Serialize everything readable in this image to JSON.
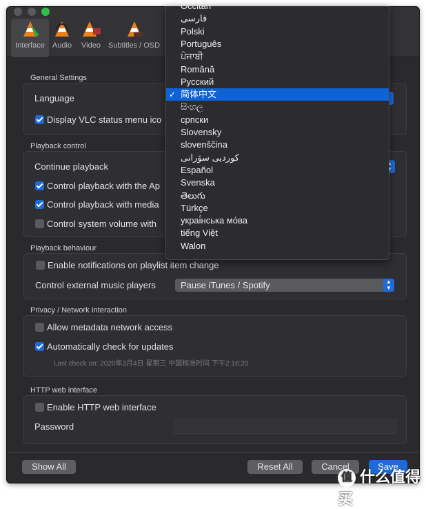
{
  "toolbar": {
    "tabs": [
      {
        "label": "Interface",
        "icon": "vlc-cone-interface-icon",
        "selected": true
      },
      {
        "label": "Audio",
        "icon": "vlc-cone-headphones-icon"
      },
      {
        "label": "Video",
        "icon": "vlc-cone-film-icon"
      },
      {
        "label": "Subtitles / OSD",
        "icon": "vlc-cone-subtitles-icon"
      }
    ]
  },
  "general": {
    "title": "General Settings",
    "language_label": "Language",
    "display_status_icon": {
      "label": "Display VLC status menu ico",
      "checked": true
    }
  },
  "playback_control": {
    "title": "Playback control",
    "continue_label": "Continue playback",
    "apple_remote": {
      "label": "Control playback with the Ap",
      "checked": true
    },
    "media_keys": {
      "label": "Control playback with media",
      "checked": true
    },
    "system_volume": {
      "label": "Control system volume with",
      "checked": false
    }
  },
  "playback_behaviour": {
    "title": "Playback behaviour",
    "notifications": {
      "label": "Enable notifications on playlist item change",
      "checked": false
    },
    "external_label": "Control external music players",
    "external_value": "Pause iTunes / Spotify"
  },
  "privacy": {
    "title": "Privacy / Network Interaction",
    "metadata": {
      "label": "Allow metadata network access",
      "checked": false
    },
    "updates": {
      "label": "Automatically check for updates",
      "checked": true
    },
    "last_check": "Last check on: 2020年3月4日 星期三 中国标准时间 下午2:16:20"
  },
  "http": {
    "title": "HTTP web interface",
    "enable": {
      "label": "Enable HTTP web interface",
      "checked": false
    },
    "password_label": "Password",
    "password_value": ""
  },
  "footer": {
    "show_all": "Show All",
    "reset_all": "Reset All",
    "cancel": "Cancel",
    "save": "Save"
  },
  "language_menu": {
    "selected": "简体中文",
    "checkmark": "✓",
    "items": [
      "Occitan",
      "فارسی",
      "Polski",
      "Português",
      "ਪੰਜਾਬੀ",
      "Română",
      "Русский",
      "简体中文",
      "සිංහල",
      "српски",
      "Slovensky",
      "slovenščina",
      "کوردیی سۆرانی",
      "Español",
      "Svenska",
      "తెలుగు",
      "Türkçe",
      "украі́нська мо́ва",
      "tiếng Việt",
      "Walon"
    ]
  },
  "watermark": "什么值得买",
  "colors": {
    "accent": "#1e6ad8",
    "background": "#2a2a2d",
    "highlight": "#0f62d6"
  }
}
